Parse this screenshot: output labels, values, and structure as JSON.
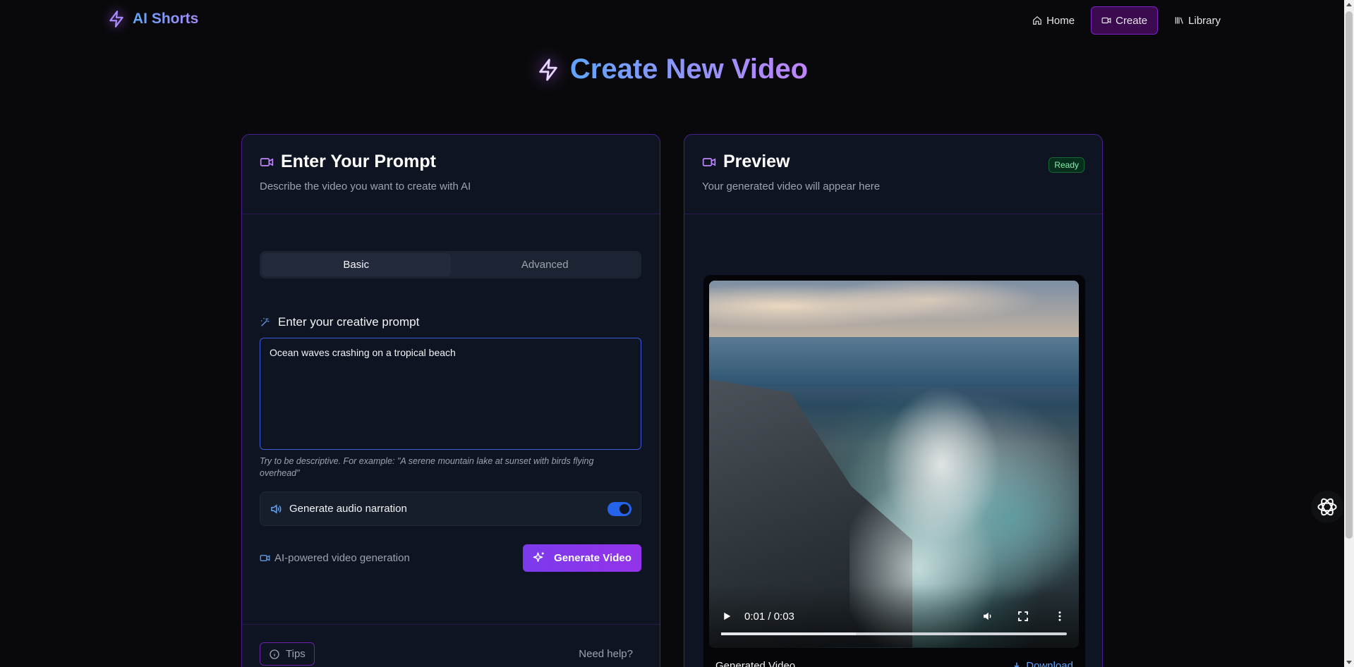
{
  "nav": {
    "logo_text": "AI Shorts",
    "links": [
      {
        "label": "Home",
        "icon": "home-icon"
      },
      {
        "label": "Create",
        "icon": "video-icon",
        "active": true
      },
      {
        "label": "Library",
        "icon": "library-icon"
      }
    ]
  },
  "page": {
    "title": "Create New Video",
    "accent_start": "#60a5fa",
    "accent_end": "#c084fc"
  },
  "prompt_card": {
    "title": "Enter Your Prompt",
    "subtitle": "Describe the video you want to create with AI",
    "tabs": [
      {
        "label": "Basic",
        "active": true
      },
      {
        "label": "Advanced",
        "active": false
      }
    ],
    "prompt_label": "Enter your creative prompt",
    "prompt_value": "Ocean waves crashing on a tropical beach",
    "hint": "Try to be descriptive. For example: \"A serene mountain lake at sunset with birds flying overhead\"",
    "audio_label": "Generate audio narration",
    "audio_enabled": true,
    "ai_note": "AI-powered video generation",
    "generate_label": "Generate Video",
    "tips_label": "Tips",
    "help_label": "Need help?"
  },
  "preview_card": {
    "title": "Preview",
    "subtitle": "Your generated video will appear here",
    "status_badge": "Ready",
    "video": {
      "time_display": "0:01 / 0:03",
      "progress_fraction": 0.39
    },
    "caption": "Generated Video",
    "download_label": "Download"
  },
  "colors": {
    "background": "#09090b",
    "card_border": "#4c1d95",
    "primary_button": "#7c3aed",
    "link": "#60a5fa",
    "ready_badge": "#86efac"
  }
}
